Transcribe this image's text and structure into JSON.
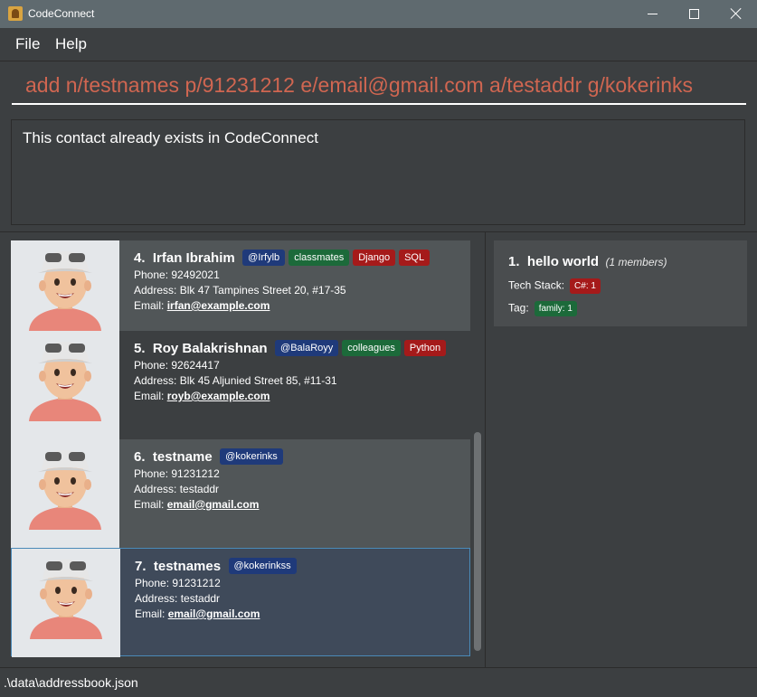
{
  "window": {
    "title": "CodeConnect"
  },
  "menu": {
    "file": "File",
    "help": "Help"
  },
  "command": {
    "value": "add n/testnames p/91231212 e/email@gmail.com a/testaddr g/kokerinks"
  },
  "result": {
    "text": "This contact already exists in CodeConnect"
  },
  "persons": [
    {
      "index": "4.",
      "name": "Irfan Ibrahim",
      "tags": [
        {
          "label": "@Irfylb",
          "color": "#1f3a7a"
        },
        {
          "label": "classmates",
          "color": "#1c6a3a"
        },
        {
          "label": "Django",
          "color": "#a51a1a"
        },
        {
          "label": "SQL",
          "color": "#a51a1a"
        }
      ],
      "phone": "Phone: 92492021",
      "address": "Address: Blk 47 Tampines Street 20, #17-35",
      "email_label": "Email:",
      "email": "irfan@example.com"
    },
    {
      "index": "5.",
      "name": "Roy Balakrishnan",
      "tags": [
        {
          "label": "@BalaRoyy",
          "color": "#1f3a7a"
        },
        {
          "label": "colleagues",
          "color": "#1c6a3a"
        },
        {
          "label": "Python",
          "color": "#a51a1a"
        }
      ],
      "phone": "Phone: 92624417",
      "address": "Address: Blk 45 Aljunied Street 85, #11-31",
      "email_label": "Email:",
      "email": "royb@example.com"
    },
    {
      "index": "6.",
      "name": "testname",
      "tags": [
        {
          "label": "@kokerinks",
          "color": "#1f3a7a"
        }
      ],
      "phone": "Phone: 91231212",
      "address": "Address: testaddr",
      "email_label": "Email:",
      "email": "email@gmail.com"
    },
    {
      "index": "7.",
      "name": "testnames",
      "tags": [
        {
          "label": "@kokerinkss",
          "color": "#1f3a7a"
        }
      ],
      "phone": "Phone: 91231212",
      "address": "Address: testaddr",
      "email_label": "Email:",
      "email": "email@gmail.com"
    }
  ],
  "group": {
    "index": "1.",
    "name": "hello world",
    "members": "(1 members)",
    "tech_stack_label": "Tech Stack:",
    "tech_stack": "C#: 1",
    "tag_label": "Tag:",
    "tag": "family: 1"
  },
  "status": {
    "path": ".\\data\\addressbook.json"
  },
  "colors": {
    "background": "#3c3f41",
    "command_text": "#d06651",
    "card_light": "#515658",
    "card_selected": "#3f4a5a",
    "tag_blue": "#1f3a7a",
    "tag_green": "#1c6a3a",
    "tag_red": "#a51a1a"
  }
}
